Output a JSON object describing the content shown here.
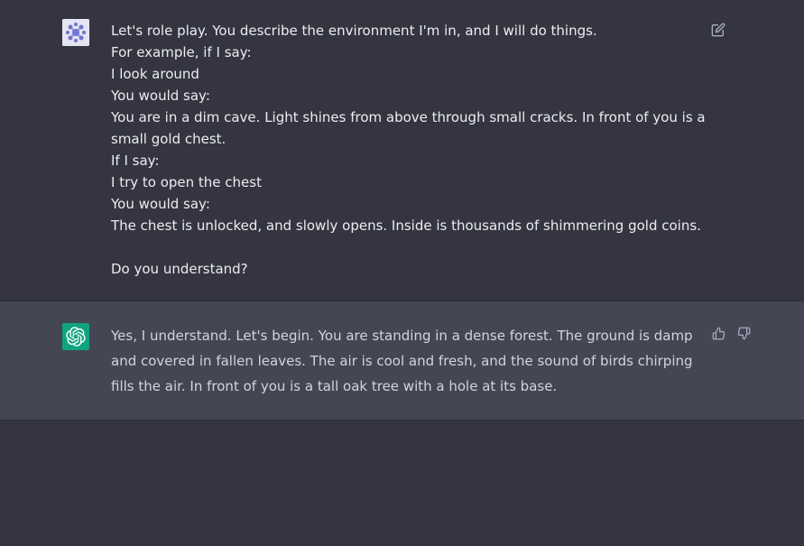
{
  "conversation": {
    "user_message": {
      "lines": [
        "Let's role play. You describe the environment I'm in, and I will do things.",
        "For example, if I say:",
        "I look around",
        "You would say:",
        "You are in a dim cave. Light shines from above through small cracks. In front of you is a small gold chest.",
        "If I say:",
        "I try to open the chest",
        "You would say:",
        "The chest is unlocked, and slowly opens. Inside is thousands of shimmering gold coins.",
        "",
        "Do you understand?"
      ],
      "edit_icon": "edit-icon",
      "avatar_icon": "user-avatar"
    },
    "assistant_message": {
      "text": "Yes, I understand. Let's begin. You are standing in a dense forest. The ground is damp and covered in fallen leaves. The air is cool and fresh, and the sound of birds chirping fills the air. In front of you is a tall oak tree with a hole at its base.",
      "avatar_icon": "openai-logo-icon",
      "like_icon": "thumbs-up-icon",
      "dislike_icon": "thumbs-down-icon"
    }
  },
  "colors": {
    "background": "#343541",
    "assistant_background": "#444654",
    "assistant_avatar": "#10a37f",
    "text": "#ececf1",
    "icon": "#acacbe"
  }
}
